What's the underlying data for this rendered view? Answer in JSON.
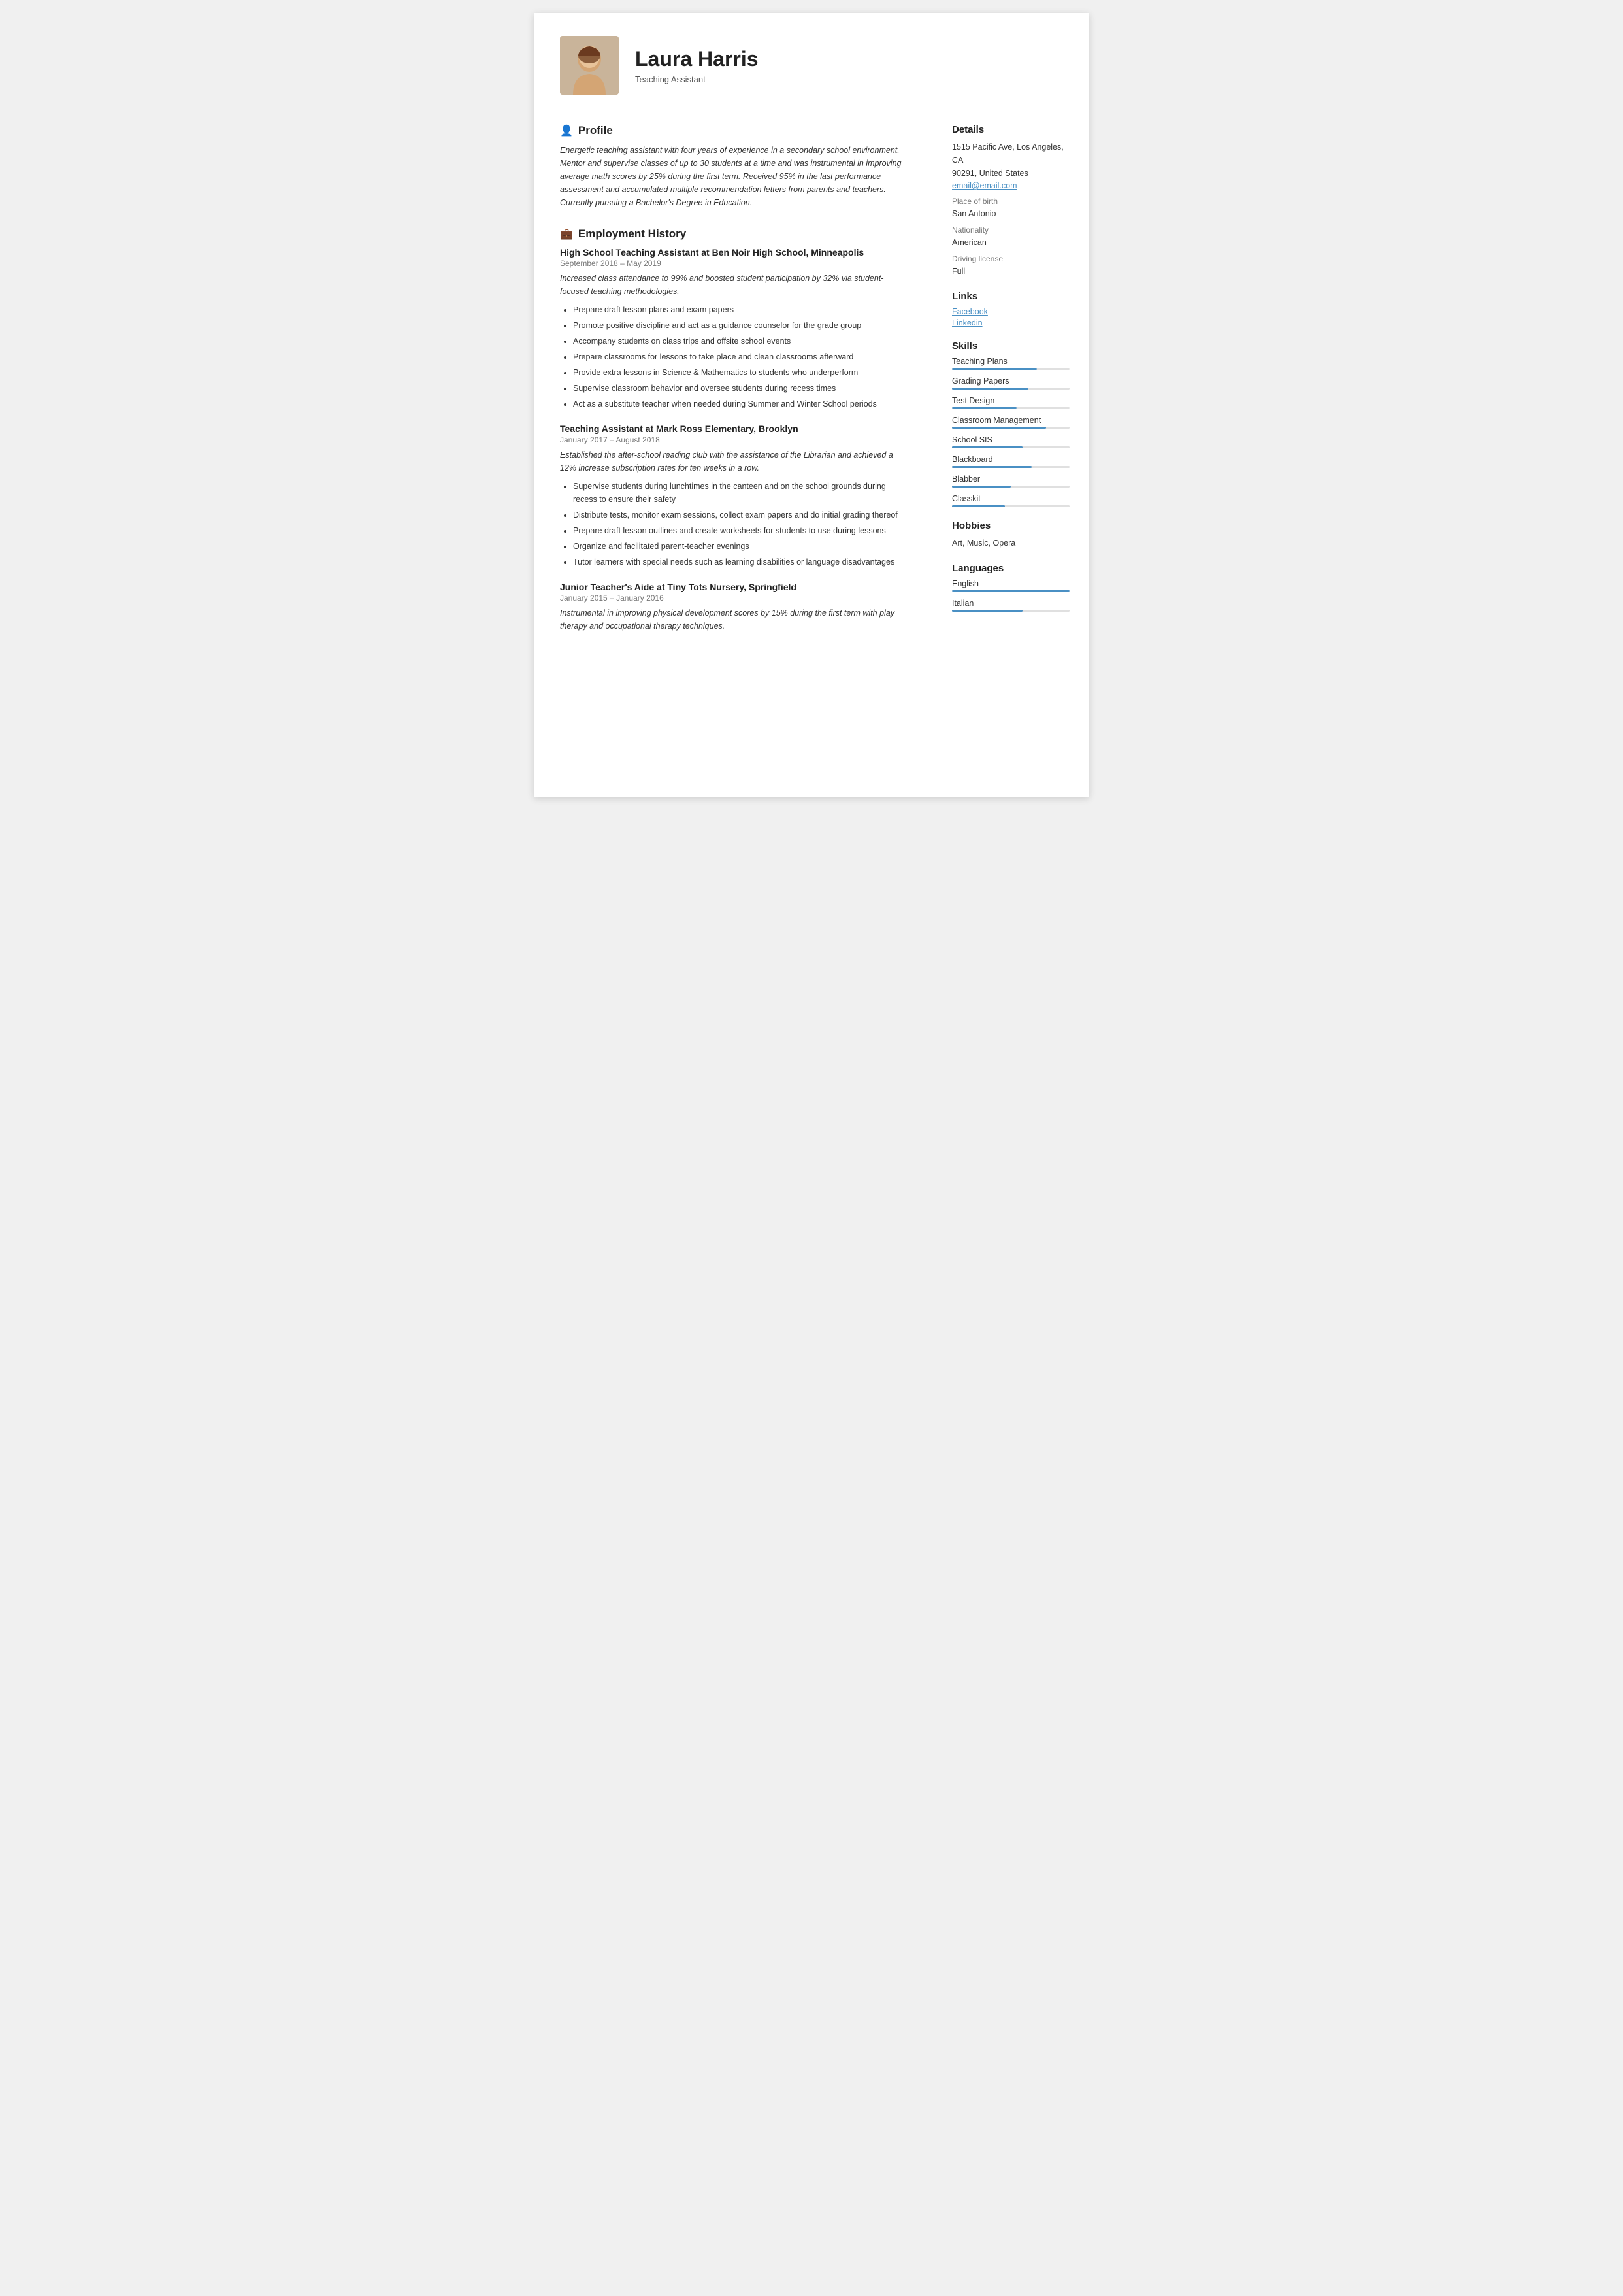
{
  "header": {
    "name": "Laura Harris",
    "title": "Teaching Assistant"
  },
  "profile": {
    "section_title": "Profile",
    "text": "Energetic teaching assistant with four years of experience in a secondary school environment. Mentor and supervise classes of up to 30 students at a time and was instrumental in improving average math scores by 25% during the first term. Received 95% in the last performance assessment and accumulated multiple recommendation letters from parents and teachers. Currently pursuing a Bachelor's Degree in Education."
  },
  "employment": {
    "section_title": "Employment History",
    "jobs": [
      {
        "title": "High School Teaching Assistant at Ben Noir High School, Minneapolis",
        "dates": "September 2018  –  May 2019",
        "description": "Increased class attendance to 99% and boosted student participation by 32% via student-focused teaching methodologies.",
        "bullets": [
          "Prepare draft lesson plans and exam papers",
          "Promote positive discipline and act as a guidance counselor for the grade group",
          "Accompany students on class trips and offsite school events",
          "Prepare classrooms for lessons to take place and clean classrooms afterward",
          "Provide extra lessons in Science & Mathematics to students who underperform",
          "Supervise classroom behavior and oversee students during recess times",
          "Act as a substitute teacher when needed during Summer and Winter School periods"
        ]
      },
      {
        "title": "Teaching Assistant at Mark Ross Elementary, Brooklyn",
        "dates": "January 2017  –  August 2018",
        "description": "Established the after-school reading club with the assistance of the Librarian and achieved a 12% increase subscription rates for ten weeks in a row.",
        "bullets": [
          "Supervise students during lunchtimes in the canteen and on the school grounds during recess to ensure their safety",
          "Distribute tests, monitor exam sessions, collect exam papers and do initial grading thereof",
          "Prepare draft lesson outlines and create worksheets for students to use during lessons",
          "Organize and facilitated parent-teacher evenings",
          "Tutor learners with special needs such as learning disabilities or language disadvantages"
        ]
      },
      {
        "title": "Junior Teacher's Aide at Tiny Tots Nursery, Springfield",
        "dates": "January 2015  –  January 2016",
        "description": "Instrumental in improving physical development scores by 15% during the first term with play therapy and occupational therapy techniques.",
        "bullets": []
      }
    ]
  },
  "details": {
    "section_title": "Details",
    "address_line1": "1515 Pacific Ave, Los Angeles, CA",
    "address_line2": "90291, United States",
    "email": "email@email.com",
    "place_of_birth_label": "Place of birth",
    "place_of_birth": "San Antonio",
    "nationality_label": "Nationality",
    "nationality": "American",
    "driving_license_label": "Driving license",
    "driving_license": "Full"
  },
  "links": {
    "section_title": "Links",
    "items": [
      {
        "label": "Facebook"
      },
      {
        "label": "Linkedin"
      }
    ]
  },
  "skills": {
    "section_title": "Skills",
    "items": [
      {
        "name": "Teaching Plans",
        "percent": 72
      },
      {
        "name": "Grading Papers",
        "percent": 65
      },
      {
        "name": "Test Design",
        "percent": 55
      },
      {
        "name": "Classroom Management",
        "percent": 80
      },
      {
        "name": "School SIS",
        "percent": 60
      },
      {
        "name": "Blackboard",
        "percent": 68
      },
      {
        "name": "Blabber",
        "percent": 50
      },
      {
        "name": "Classkit",
        "percent": 45
      }
    ]
  },
  "hobbies": {
    "section_title": "Hobbies",
    "text": "Art, Music, Opera"
  },
  "languages": {
    "section_title": "Languages",
    "items": [
      {
        "name": "English",
        "percent": 100
      },
      {
        "name": "Italian",
        "percent": 60
      }
    ]
  }
}
